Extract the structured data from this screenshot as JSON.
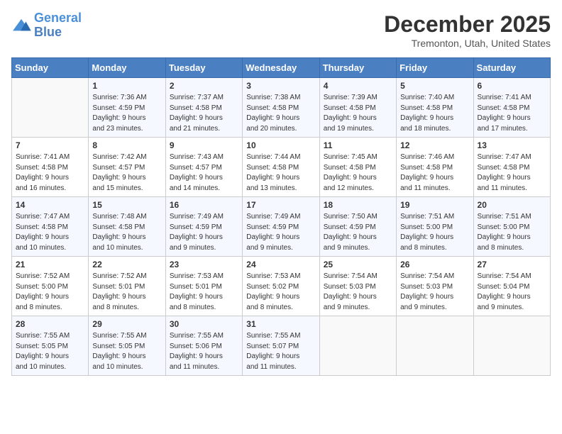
{
  "header": {
    "logo_line1": "General",
    "logo_line2": "Blue",
    "title": "December 2025",
    "subtitle": "Tremonton, Utah, United States"
  },
  "weekdays": [
    "Sunday",
    "Monday",
    "Tuesday",
    "Wednesday",
    "Thursday",
    "Friday",
    "Saturday"
  ],
  "weeks": [
    [
      {
        "day": "",
        "info": ""
      },
      {
        "day": "1",
        "info": "Sunrise: 7:36 AM\nSunset: 4:59 PM\nDaylight: 9 hours\nand 23 minutes."
      },
      {
        "day": "2",
        "info": "Sunrise: 7:37 AM\nSunset: 4:58 PM\nDaylight: 9 hours\nand 21 minutes."
      },
      {
        "day": "3",
        "info": "Sunrise: 7:38 AM\nSunset: 4:58 PM\nDaylight: 9 hours\nand 20 minutes."
      },
      {
        "day": "4",
        "info": "Sunrise: 7:39 AM\nSunset: 4:58 PM\nDaylight: 9 hours\nand 19 minutes."
      },
      {
        "day": "5",
        "info": "Sunrise: 7:40 AM\nSunset: 4:58 PM\nDaylight: 9 hours\nand 18 minutes."
      },
      {
        "day": "6",
        "info": "Sunrise: 7:41 AM\nSunset: 4:58 PM\nDaylight: 9 hours\nand 17 minutes."
      }
    ],
    [
      {
        "day": "7",
        "info": "Sunrise: 7:41 AM\nSunset: 4:58 PM\nDaylight: 9 hours\nand 16 minutes."
      },
      {
        "day": "8",
        "info": "Sunrise: 7:42 AM\nSunset: 4:57 PM\nDaylight: 9 hours\nand 15 minutes."
      },
      {
        "day": "9",
        "info": "Sunrise: 7:43 AM\nSunset: 4:57 PM\nDaylight: 9 hours\nand 14 minutes."
      },
      {
        "day": "10",
        "info": "Sunrise: 7:44 AM\nSunset: 4:58 PM\nDaylight: 9 hours\nand 13 minutes."
      },
      {
        "day": "11",
        "info": "Sunrise: 7:45 AM\nSunset: 4:58 PM\nDaylight: 9 hours\nand 12 minutes."
      },
      {
        "day": "12",
        "info": "Sunrise: 7:46 AM\nSunset: 4:58 PM\nDaylight: 9 hours\nand 11 minutes."
      },
      {
        "day": "13",
        "info": "Sunrise: 7:47 AM\nSunset: 4:58 PM\nDaylight: 9 hours\nand 11 minutes."
      }
    ],
    [
      {
        "day": "14",
        "info": "Sunrise: 7:47 AM\nSunset: 4:58 PM\nDaylight: 9 hours\nand 10 minutes."
      },
      {
        "day": "15",
        "info": "Sunrise: 7:48 AM\nSunset: 4:58 PM\nDaylight: 9 hours\nand 10 minutes."
      },
      {
        "day": "16",
        "info": "Sunrise: 7:49 AM\nSunset: 4:59 PM\nDaylight: 9 hours\nand 9 minutes."
      },
      {
        "day": "17",
        "info": "Sunrise: 7:49 AM\nSunset: 4:59 PM\nDaylight: 9 hours\nand 9 minutes."
      },
      {
        "day": "18",
        "info": "Sunrise: 7:50 AM\nSunset: 4:59 PM\nDaylight: 9 hours\nand 9 minutes."
      },
      {
        "day": "19",
        "info": "Sunrise: 7:51 AM\nSunset: 5:00 PM\nDaylight: 9 hours\nand 8 minutes."
      },
      {
        "day": "20",
        "info": "Sunrise: 7:51 AM\nSunset: 5:00 PM\nDaylight: 9 hours\nand 8 minutes."
      }
    ],
    [
      {
        "day": "21",
        "info": "Sunrise: 7:52 AM\nSunset: 5:00 PM\nDaylight: 9 hours\nand 8 minutes."
      },
      {
        "day": "22",
        "info": "Sunrise: 7:52 AM\nSunset: 5:01 PM\nDaylight: 9 hours\nand 8 minutes."
      },
      {
        "day": "23",
        "info": "Sunrise: 7:53 AM\nSunset: 5:01 PM\nDaylight: 9 hours\nand 8 minutes."
      },
      {
        "day": "24",
        "info": "Sunrise: 7:53 AM\nSunset: 5:02 PM\nDaylight: 9 hours\nand 8 minutes."
      },
      {
        "day": "25",
        "info": "Sunrise: 7:54 AM\nSunset: 5:03 PM\nDaylight: 9 hours\nand 9 minutes."
      },
      {
        "day": "26",
        "info": "Sunrise: 7:54 AM\nSunset: 5:03 PM\nDaylight: 9 hours\nand 9 minutes."
      },
      {
        "day": "27",
        "info": "Sunrise: 7:54 AM\nSunset: 5:04 PM\nDaylight: 9 hours\nand 9 minutes."
      }
    ],
    [
      {
        "day": "28",
        "info": "Sunrise: 7:55 AM\nSunset: 5:05 PM\nDaylight: 9 hours\nand 10 minutes."
      },
      {
        "day": "29",
        "info": "Sunrise: 7:55 AM\nSunset: 5:05 PM\nDaylight: 9 hours\nand 10 minutes."
      },
      {
        "day": "30",
        "info": "Sunrise: 7:55 AM\nSunset: 5:06 PM\nDaylight: 9 hours\nand 11 minutes."
      },
      {
        "day": "31",
        "info": "Sunrise: 7:55 AM\nSunset: 5:07 PM\nDaylight: 9 hours\nand 11 minutes."
      },
      {
        "day": "",
        "info": ""
      },
      {
        "day": "",
        "info": ""
      },
      {
        "day": "",
        "info": ""
      }
    ]
  ]
}
